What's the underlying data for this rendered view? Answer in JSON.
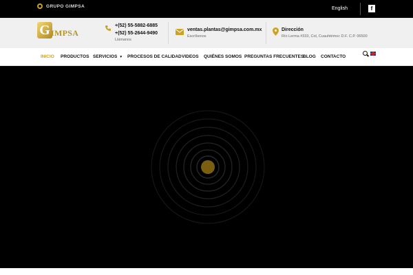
{
  "topbar": {
    "brand": "GRUPO GIMPSA",
    "language": "English",
    "social_icon": "f"
  },
  "logo": {
    "letter": "G",
    "text": "IMPSA"
  },
  "contact": {
    "phone1": "+(52) 55-5882-6885",
    "phone2": "+(52) 55-2644-9490",
    "phone_caption": "Llámanos",
    "email": "ventas.plantas@gimpsa.com.mx",
    "email_caption": "Escríbenos",
    "address_title": "Dirección",
    "address": "Río Lerma #333, Col, Cuauhtémoc D.F. C.P. 06500"
  },
  "nav": {
    "items": [
      {
        "label": "INICIO",
        "active": true
      },
      {
        "label": "PRODUCTOS"
      },
      {
        "label": "SERVICIOS",
        "dropdown": true
      },
      {
        "label": "PROCESOS DE CALIDAD"
      },
      {
        "label": "VIDEOS"
      },
      {
        "label": "QUIÉNES SOMOS"
      },
      {
        "label": "PREGUNTAS FRECUENTES"
      },
      {
        "label": "BLOG"
      },
      {
        "label": "CONTACTO"
      }
    ]
  },
  "colors": {
    "accent": "#c9a227",
    "background": "#000000"
  },
  "icons": [
    "gear-icon",
    "facebook-icon",
    "phone-icon",
    "mail-icon",
    "location-icon",
    "search-icon",
    "uk-flag-icon",
    "chevron-down-icon"
  ]
}
